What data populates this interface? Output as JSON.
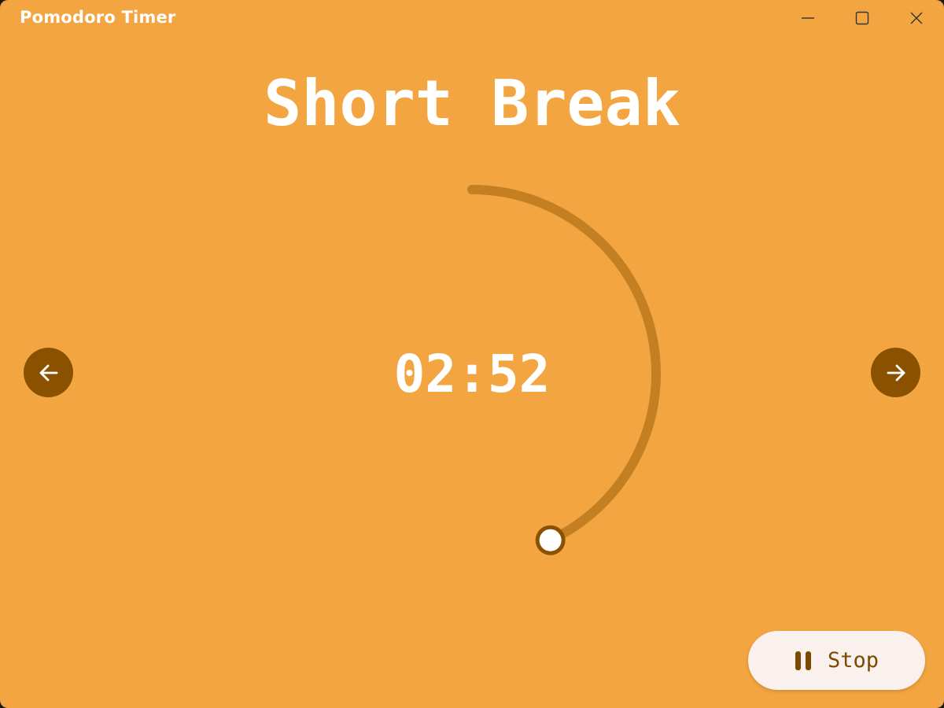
{
  "window": {
    "title": "Pomodoro Timer",
    "controls": {
      "minimize_icon": "minimize-icon",
      "maximize_icon": "maximize-icon",
      "close_icon": "close-icon"
    }
  },
  "timer": {
    "mode": "Short Break",
    "time_remaining": "02:52",
    "progress_fraction": 0.43
  },
  "navigation": {
    "previous_icon": "arrow-left-icon",
    "next_icon": "arrow-right-icon"
  },
  "actions": {
    "stop_label": "Stop",
    "stop_icon": "pause-icon"
  },
  "colors": {
    "background": "#F2A541",
    "accent_dark": "#8A5200",
    "ring_track": "#C47F22",
    "text": "#FFFFFF",
    "button_background": "#FAF1EE",
    "button_text": "#7A4A00"
  }
}
